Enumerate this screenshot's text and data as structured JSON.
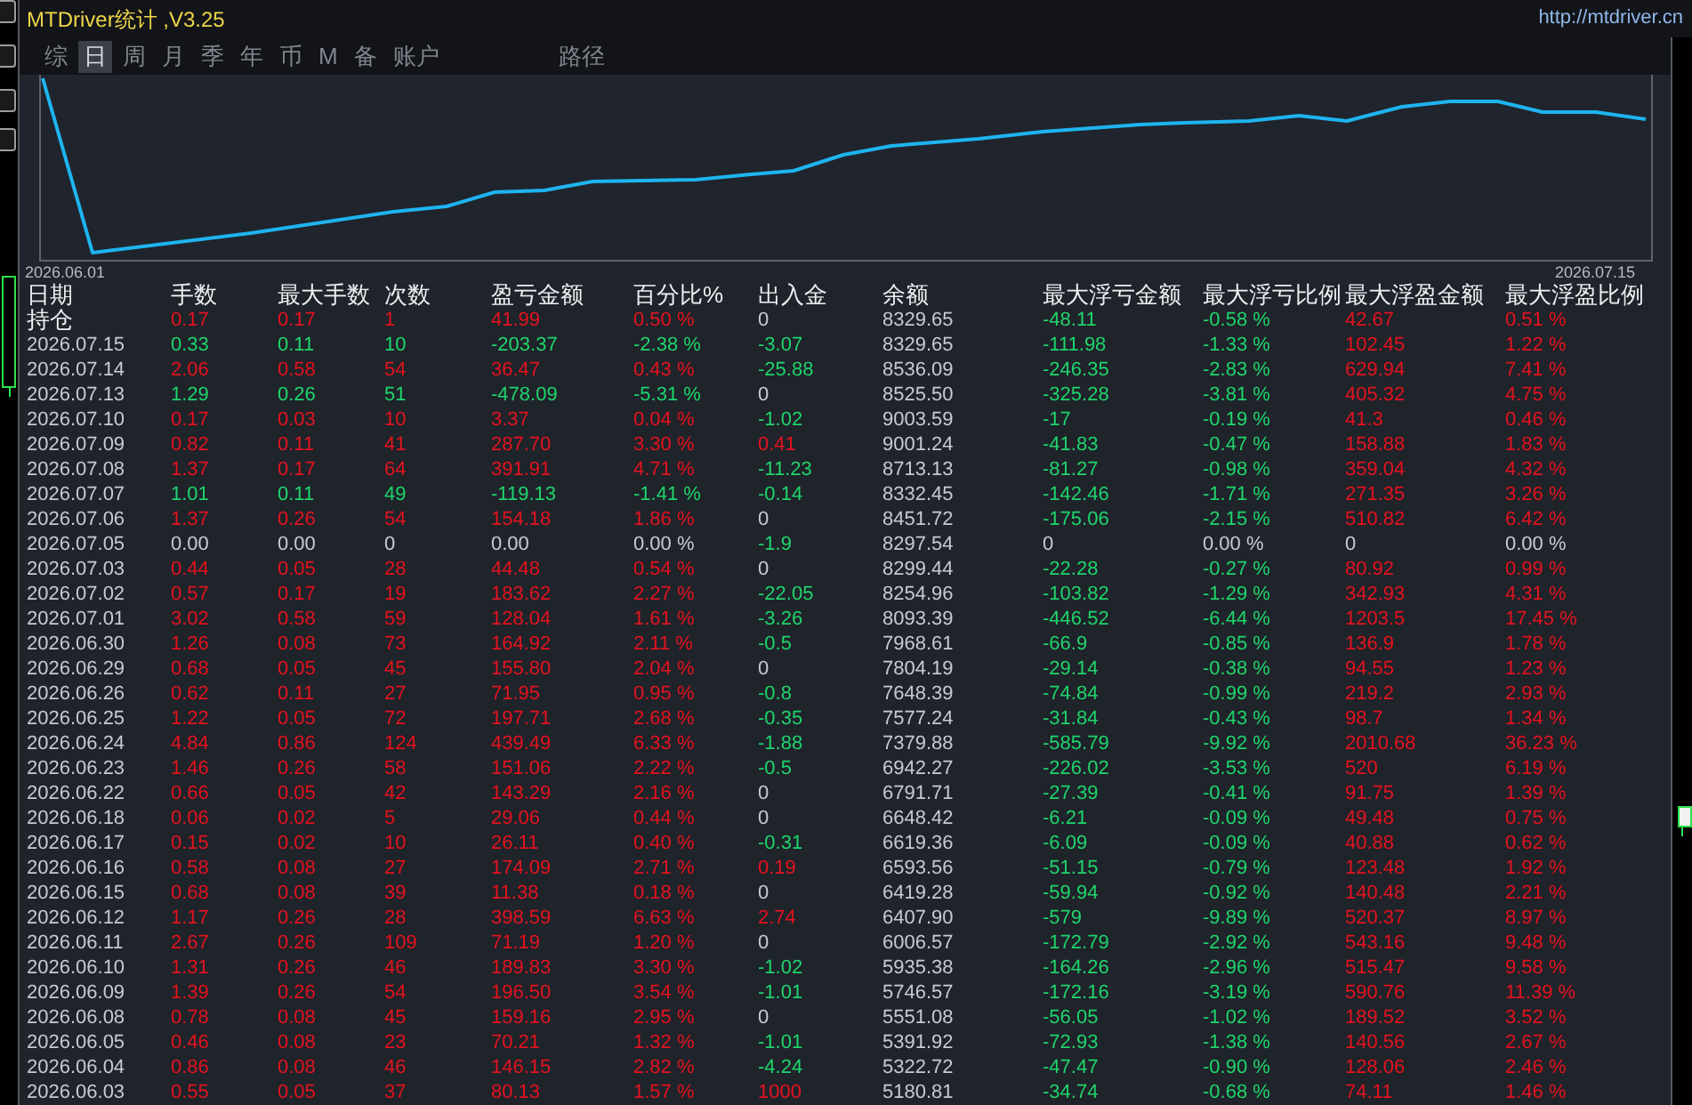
{
  "title": "MTDriver统计 ,V3.25",
  "url": "http://mtdriver.cn",
  "tabs": [
    {
      "label": "综",
      "selected": false
    },
    {
      "label": "日",
      "selected": true
    },
    {
      "label": "周",
      "selected": false
    },
    {
      "label": "月",
      "selected": false
    },
    {
      "label": "季",
      "selected": false
    },
    {
      "label": "年",
      "selected": false
    },
    {
      "label": "币",
      "selected": false
    },
    {
      "label": "M",
      "selected": false
    },
    {
      "label": "备",
      "selected": false
    },
    {
      "label": "账户",
      "selected": false
    }
  ],
  "path_tab": {
    "label": "路径",
    "selected": false
  },
  "equity_chart": {
    "x_start_label": "2026.06.01",
    "x_end_label": "2026.07.15"
  },
  "table": {
    "columns": [
      "日期",
      "手数",
      "最大手数",
      "次数",
      "盈亏金额",
      "百分比%",
      "出入金",
      "余额",
      "最大浮亏金额",
      "最大浮亏比例",
      "最大浮盈金额",
      "最大浮盈比例"
    ],
    "open_positions": {
      "label": "持仓",
      "kind": "profit",
      "trade_stats": [
        "0.17",
        "0.17",
        "1",
        "41.99",
        "0.50 %"
      ],
      "transfer": {
        "kind": "zero",
        "text": "0"
      },
      "balance": "8329.65",
      "float_stats": [
        "-48.11",
        "-0.58 %",
        "42.67",
        "0.51 %"
      ]
    },
    "rows": [
      {
        "date": "2026.07.15",
        "kind": "loss",
        "trade_stats": [
          "0.33",
          "0.11",
          "10",
          "-203.37",
          "-2.38 %"
        ],
        "transfer": {
          "kind": "withdrawal",
          "text": "-3.07"
        },
        "balance": "8329.65",
        "float_stats": [
          "-111.98",
          "-1.33 %",
          "102.45",
          "1.22 %"
        ]
      },
      {
        "date": "2026.07.14",
        "kind": "profit",
        "trade_stats": [
          "2.06",
          "0.58",
          "54",
          "36.47",
          "0.43 %"
        ],
        "transfer": {
          "kind": "withdrawal",
          "text": "-25.88"
        },
        "balance": "8536.09",
        "float_stats": [
          "-246.35",
          "-2.83 %",
          "629.94",
          "7.41 %"
        ]
      },
      {
        "date": "2026.07.13",
        "kind": "loss",
        "trade_stats": [
          "1.29",
          "0.26",
          "51",
          "-478.09",
          "-5.31 %"
        ],
        "transfer": {
          "kind": "zero",
          "text": "0"
        },
        "balance": "8525.50",
        "float_stats": [
          "-325.28",
          "-3.81 %",
          "405.32",
          "4.75 %"
        ]
      },
      {
        "date": "2026.07.10",
        "kind": "profit",
        "trade_stats": [
          "0.17",
          "0.03",
          "10",
          "3.37",
          "0.04 %"
        ],
        "transfer": {
          "kind": "withdrawal",
          "text": "-1.02"
        },
        "balance": "9003.59",
        "float_stats": [
          "-17",
          "-0.19 %",
          "41.3",
          "0.46 %"
        ]
      },
      {
        "date": "2026.07.09",
        "kind": "profit",
        "trade_stats": [
          "0.82",
          "0.11",
          "41",
          "287.70",
          "3.30 %"
        ],
        "transfer": {
          "kind": "deposit",
          "text": "0.41"
        },
        "balance": "9001.24",
        "float_stats": [
          "-41.83",
          "-0.47 %",
          "158.88",
          "1.83 %"
        ]
      },
      {
        "date": "2026.07.08",
        "kind": "profit",
        "trade_stats": [
          "1.37",
          "0.17",
          "64",
          "391.91",
          "4.71 %"
        ],
        "transfer": {
          "kind": "withdrawal",
          "text": "-11.23"
        },
        "balance": "8713.13",
        "float_stats": [
          "-81.27",
          "-0.98 %",
          "359.04",
          "4.32 %"
        ]
      },
      {
        "date": "2026.07.07",
        "kind": "loss",
        "trade_stats": [
          "1.01",
          "0.11",
          "49",
          "-119.13",
          "-1.41 %"
        ],
        "transfer": {
          "kind": "withdrawal",
          "text": "-0.14"
        },
        "balance": "8332.45",
        "float_stats": [
          "-142.46",
          "-1.71 %",
          "271.35",
          "3.26 %"
        ]
      },
      {
        "date": "2026.07.06",
        "kind": "profit",
        "trade_stats": [
          "1.37",
          "0.26",
          "54",
          "154.18",
          "1.86 %"
        ],
        "transfer": {
          "kind": "zero",
          "text": "0"
        },
        "balance": "8451.72",
        "float_stats": [
          "-175.06",
          "-2.15 %",
          "510.82",
          "6.42 %"
        ]
      },
      {
        "date": "2026.07.05",
        "kind": "flat",
        "trade_stats": [
          "0.00",
          "0.00",
          "0",
          "0.00",
          "0.00 %"
        ],
        "transfer": {
          "kind": "withdrawal",
          "text": "-1.9"
        },
        "balance": "8297.54",
        "float_stats": [
          "0",
          "0.00 %",
          "0",
          "0.00 %"
        ]
      },
      {
        "date": "2026.07.03",
        "kind": "profit",
        "trade_stats": [
          "0.44",
          "0.05",
          "28",
          "44.48",
          "0.54 %"
        ],
        "transfer": {
          "kind": "zero",
          "text": "0"
        },
        "balance": "8299.44",
        "float_stats": [
          "-22.28",
          "-0.27 %",
          "80.92",
          "0.99 %"
        ]
      },
      {
        "date": "2026.07.02",
        "kind": "profit",
        "trade_stats": [
          "0.57",
          "0.17",
          "19",
          "183.62",
          "2.27 %"
        ],
        "transfer": {
          "kind": "withdrawal",
          "text": "-22.05"
        },
        "balance": "8254.96",
        "float_stats": [
          "-103.82",
          "-1.29 %",
          "342.93",
          "4.31 %"
        ]
      },
      {
        "date": "2026.07.01",
        "kind": "profit",
        "trade_stats": [
          "3.02",
          "0.58",
          "59",
          "128.04",
          "1.61 %"
        ],
        "transfer": {
          "kind": "withdrawal",
          "text": "-3.26"
        },
        "balance": "8093.39",
        "float_stats": [
          "-446.52",
          "-6.44 %",
          "1203.5",
          "17.45 %"
        ]
      },
      {
        "date": "2026.06.30",
        "kind": "profit",
        "trade_stats": [
          "1.26",
          "0.08",
          "73",
          "164.92",
          "2.11 %"
        ],
        "transfer": {
          "kind": "withdrawal",
          "text": "-0.5"
        },
        "balance": "7968.61",
        "float_stats": [
          "-66.9",
          "-0.85 %",
          "136.9",
          "1.78 %"
        ]
      },
      {
        "date": "2026.06.29",
        "kind": "profit",
        "trade_stats": [
          "0.68",
          "0.05",
          "45",
          "155.80",
          "2.04 %"
        ],
        "transfer": {
          "kind": "zero",
          "text": "0"
        },
        "balance": "7804.19",
        "float_stats": [
          "-29.14",
          "-0.38 %",
          "94.55",
          "1.23 %"
        ]
      },
      {
        "date": "2026.06.26",
        "kind": "profit",
        "trade_stats": [
          "0.62",
          "0.11",
          "27",
          "71.95",
          "0.95 %"
        ],
        "transfer": {
          "kind": "withdrawal",
          "text": "-0.8"
        },
        "balance": "7648.39",
        "float_stats": [
          "-74.84",
          "-0.99 %",
          "219.2",
          "2.93 %"
        ]
      },
      {
        "date": "2026.06.25",
        "kind": "profit",
        "trade_stats": [
          "1.22",
          "0.05",
          "72",
          "197.71",
          "2.68 %"
        ],
        "transfer": {
          "kind": "withdrawal",
          "text": "-0.35"
        },
        "balance": "7577.24",
        "float_stats": [
          "-31.84",
          "-0.43 %",
          "98.7",
          "1.34 %"
        ]
      },
      {
        "date": "2026.06.24",
        "kind": "profit",
        "trade_stats": [
          "4.84",
          "0.86",
          "124",
          "439.49",
          "6.33 %"
        ],
        "transfer": {
          "kind": "withdrawal",
          "text": "-1.88"
        },
        "balance": "7379.88",
        "float_stats": [
          "-585.79",
          "-9.92 %",
          "2010.68",
          "36.23 %"
        ]
      },
      {
        "date": "2026.06.23",
        "kind": "profit",
        "trade_stats": [
          "1.46",
          "0.26",
          "58",
          "151.06",
          "2.22 %"
        ],
        "transfer": {
          "kind": "withdrawal",
          "text": "-0.5"
        },
        "balance": "6942.27",
        "float_stats": [
          "-226.02",
          "-3.53 %",
          "520",
          "6.19 %"
        ]
      },
      {
        "date": "2026.06.22",
        "kind": "profit",
        "trade_stats": [
          "0.66",
          "0.05",
          "42",
          "143.29",
          "2.16 %"
        ],
        "transfer": {
          "kind": "zero",
          "text": "0"
        },
        "balance": "6791.71",
        "float_stats": [
          "-27.39",
          "-0.41 %",
          "91.75",
          "1.39 %"
        ]
      },
      {
        "date": "2026.06.18",
        "kind": "profit",
        "trade_stats": [
          "0.06",
          "0.02",
          "5",
          "29.06",
          "0.44 %"
        ],
        "transfer": {
          "kind": "zero",
          "text": "0"
        },
        "balance": "6648.42",
        "float_stats": [
          "-6.21",
          "-0.09 %",
          "49.48",
          "0.75 %"
        ]
      },
      {
        "date": "2026.06.17",
        "kind": "profit",
        "trade_stats": [
          "0.15",
          "0.02",
          "10",
          "26.11",
          "0.40 %"
        ],
        "transfer": {
          "kind": "withdrawal",
          "text": "-0.31"
        },
        "balance": "6619.36",
        "float_stats": [
          "-6.09",
          "-0.09 %",
          "40.88",
          "0.62 %"
        ]
      },
      {
        "date": "2026.06.16",
        "kind": "profit",
        "trade_stats": [
          "0.58",
          "0.08",
          "27",
          "174.09",
          "2.71 %"
        ],
        "transfer": {
          "kind": "deposit",
          "text": "0.19"
        },
        "balance": "6593.56",
        "float_stats": [
          "-51.15",
          "-0.79 %",
          "123.48",
          "1.92 %"
        ]
      },
      {
        "date": "2026.06.15",
        "kind": "profit",
        "trade_stats": [
          "0.68",
          "0.08",
          "39",
          "11.38",
          "0.18 %"
        ],
        "transfer": {
          "kind": "zero",
          "text": "0"
        },
        "balance": "6419.28",
        "float_stats": [
          "-59.94",
          "-0.92 %",
          "140.48",
          "2.21 %"
        ]
      },
      {
        "date": "2026.06.12",
        "kind": "profit",
        "trade_stats": [
          "1.17",
          "0.26",
          "28",
          "398.59",
          "6.63 %"
        ],
        "transfer": {
          "kind": "deposit",
          "text": "2.74"
        },
        "balance": "6407.90",
        "float_stats": [
          "-579",
          "-9.89 %",
          "520.37",
          "8.97 %"
        ]
      },
      {
        "date": "2026.06.11",
        "kind": "profit",
        "trade_stats": [
          "2.67",
          "0.26",
          "109",
          "71.19",
          "1.20 %"
        ],
        "transfer": {
          "kind": "zero",
          "text": "0"
        },
        "balance": "6006.57",
        "float_stats": [
          "-172.79",
          "-2.92 %",
          "543.16",
          "9.48 %"
        ]
      },
      {
        "date": "2026.06.10",
        "kind": "profit",
        "trade_stats": [
          "1.31",
          "0.26",
          "46",
          "189.83",
          "3.30 %"
        ],
        "transfer": {
          "kind": "withdrawal",
          "text": "-1.02"
        },
        "balance": "5935.38",
        "float_stats": [
          "-164.26",
          "-2.96 %",
          "515.47",
          "9.58 %"
        ]
      },
      {
        "date": "2026.06.09",
        "kind": "profit",
        "trade_stats": [
          "1.39",
          "0.26",
          "54",
          "196.50",
          "3.54 %"
        ],
        "transfer": {
          "kind": "withdrawal",
          "text": "-1.01"
        },
        "balance": "5746.57",
        "float_stats": [
          "-172.16",
          "-3.19 %",
          "590.76",
          "11.39 %"
        ]
      },
      {
        "date": "2026.06.08",
        "kind": "profit",
        "trade_stats": [
          "0.78",
          "0.08",
          "45",
          "159.16",
          "2.95 %"
        ],
        "transfer": {
          "kind": "zero",
          "text": "0"
        },
        "balance": "5551.08",
        "float_stats": [
          "-56.05",
          "-1.02 %",
          "189.52",
          "3.52 %"
        ]
      },
      {
        "date": "2026.06.05",
        "kind": "profit",
        "trade_stats": [
          "0.46",
          "0.08",
          "23",
          "70.21",
          "1.32 %"
        ],
        "transfer": {
          "kind": "withdrawal",
          "text": "-1.01"
        },
        "balance": "5391.92",
        "float_stats": [
          "-72.93",
          "-1.38 %",
          "140.56",
          "2.67 %"
        ]
      },
      {
        "date": "2026.06.04",
        "kind": "profit",
        "trade_stats": [
          "0.86",
          "0.08",
          "46",
          "146.15",
          "2.82 %"
        ],
        "transfer": {
          "kind": "withdrawal",
          "text": "-4.24"
        },
        "balance": "5322.72",
        "float_stats": [
          "-47.47",
          "-0.90 %",
          "128.06",
          "2.46 %"
        ]
      },
      {
        "date": "2026.06.03",
        "kind": "profit",
        "trade_stats": [
          "0.55",
          "0.05",
          "37",
          "80.13",
          "1.57 %"
        ],
        "transfer": {
          "kind": "deposit",
          "text": "1000"
        },
        "balance": "5180.81",
        "float_stats": [
          "-34.74",
          "-0.68 %",
          "74.11",
          "1.46 %"
        ]
      }
    ]
  }
}
